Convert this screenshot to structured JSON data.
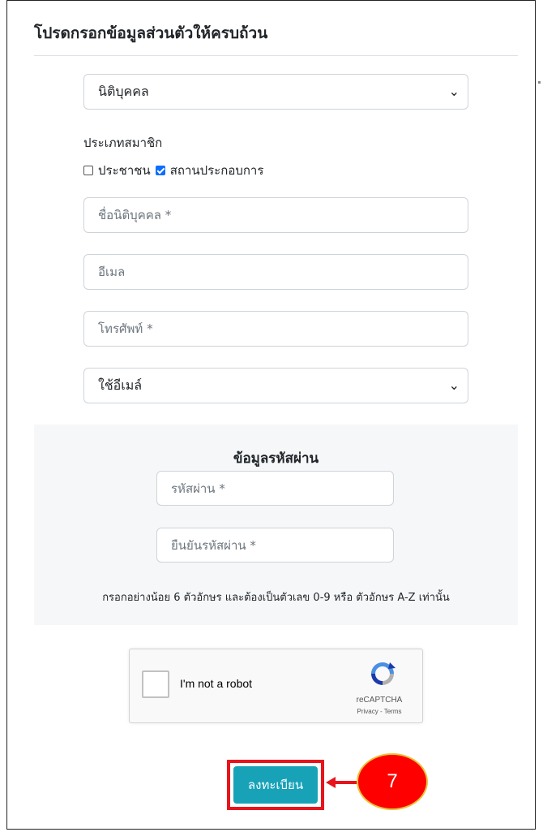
{
  "header": {
    "title": "โปรดกรอกข้อมูลส่วนตัวให้ครบถ้วน"
  },
  "entity_select": {
    "value": "นิติบุคคล"
  },
  "member_type": {
    "label": "ประเภทสมาชิก",
    "options": [
      {
        "label": "ประชาชน",
        "checked": false
      },
      {
        "label": "สถานประกอบการ",
        "checked": true
      }
    ]
  },
  "fields": {
    "name_placeholder": "ชื่อนิติบุคคล *",
    "email_placeholder": "อีเมล",
    "phone_placeholder": "โทรศัพท์ *"
  },
  "contact_select": {
    "value": "ใช้อีเมล์"
  },
  "password": {
    "title": "ข้อมูลรหัสผ่าน",
    "password_placeholder": "รหัสผ่าน *",
    "confirm_placeholder": "ยืนยันรหัสผ่าน *",
    "hint": "กรอกอย่างน้อย 6 ตัวอักษร และต้องเป็นตัวเลข 0-9 หรือ ตัวอักษร A-Z เท่านั้น"
  },
  "captcha": {
    "label": "I'm not a robot",
    "brand": "reCAPTCHA",
    "links": "Privacy - Terms"
  },
  "register_button": {
    "label": "ลงทะเบียน"
  },
  "annotation": {
    "step": "7",
    "color": "#ff0000",
    "highlight": "#e8141c"
  },
  "colors": {
    "button": "#17a2b8",
    "checkbox": "#0d6efd"
  }
}
